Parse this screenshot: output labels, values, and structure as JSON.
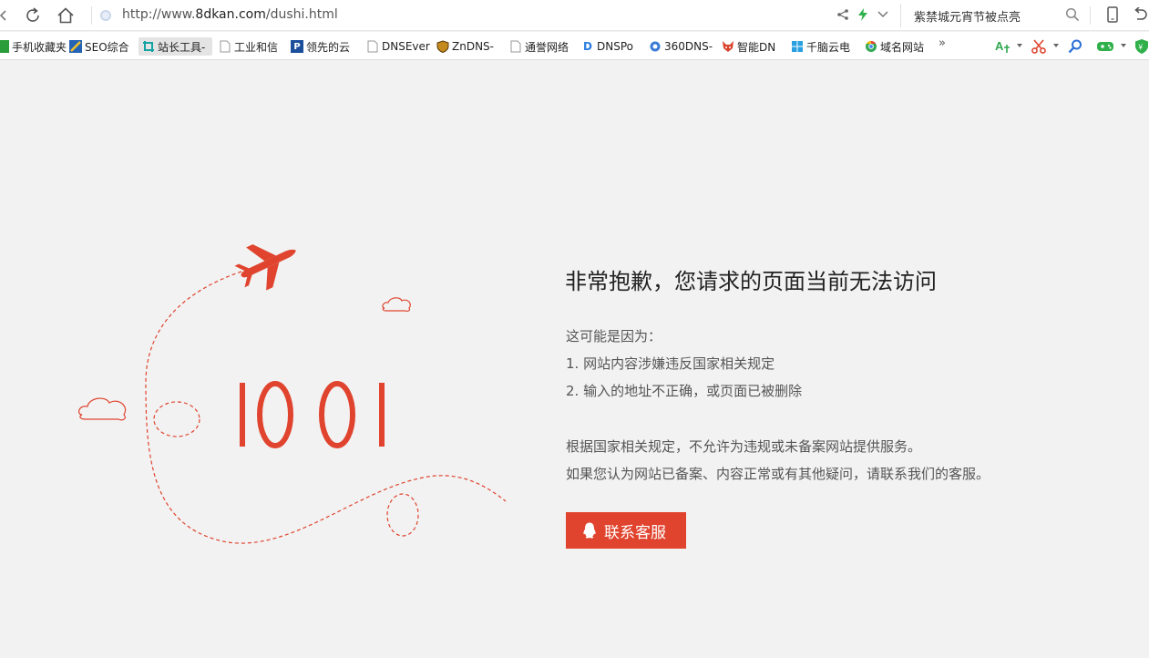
{
  "browser": {
    "url": {
      "prefix": "http://www.",
      "domain": "8dkan.com",
      "path": "/dushi.html"
    },
    "search_text": "紫禁城元宵节被点亮",
    "icons": {
      "back": "chevron-left-icon",
      "reload": "reload-icon",
      "home": "home-icon",
      "share": "share-icon",
      "speed": "lightning-icon",
      "dropdown": "chevron-down-icon",
      "search": "search-icon",
      "phone": "phone-icon",
      "undo": "undo-icon"
    },
    "accent": "#e0442f"
  },
  "bookmarks": {
    "items": [
      {
        "label": "手机收藏夹",
        "icon": "mobile-icon",
        "color": "#2a9d3a"
      },
      {
        "label": "SEO综合",
        "icon": "seo-icon",
        "color": "#2563b5"
      },
      {
        "label": "站长工具-",
        "icon": "chinaz-icon",
        "color": "#15a3a3"
      },
      {
        "label": "工业和信",
        "icon": "page-icon",
        "color": "#999999"
      },
      {
        "label": "领先的云",
        "icon": "p-logo-icon",
        "color": "#1b4e9b"
      },
      {
        "label": "DNSEver",
        "icon": "page-icon",
        "color": "#999999"
      },
      {
        "label": "ZnDNS-",
        "icon": "shield-icon",
        "color": "#c48a1d"
      },
      {
        "label": "通誉网络",
        "icon": "page-icon",
        "color": "#999999"
      },
      {
        "label": "DNSPo",
        "icon": "dnspod-icon",
        "color": "#2b7de0"
      },
      {
        "label": "360DNS-",
        "icon": "360-icon",
        "color": "#3a7bd5"
      },
      {
        "label": "智能DN",
        "icon": "fox-icon",
        "color": "#d9452c"
      },
      {
        "label": "千脑云电",
        "icon": "windows-icon",
        "color": "#2aa0e0"
      },
      {
        "label": "域名网站",
        "icon": "chrome-icon",
        "color": "#34a853"
      }
    ],
    "more_label": "»",
    "tool_icons": [
      "translate-icon",
      "scissors-icon",
      "magnifier-icon",
      "gamepad-icon",
      "security-shield-icon"
    ]
  },
  "error_page": {
    "code_graphic": "IOOI",
    "title": "非常抱歉，您请求的页面当前无法访问",
    "reason_intro": "这可能是因为：",
    "reasons": [
      "1. 网站内容涉嫌违反国家相关规定",
      "2. 输入的地址不正确，或页面已被删除"
    ],
    "notes": [
      "根据国家相关规定，不允许为违规或未备案网站提供服务。",
      "如果您认为网站已备案、内容正常或有其他疑问，请联系我们的客服。"
    ],
    "contact_button": "联系客服",
    "illustration_color": "#e0442f"
  }
}
